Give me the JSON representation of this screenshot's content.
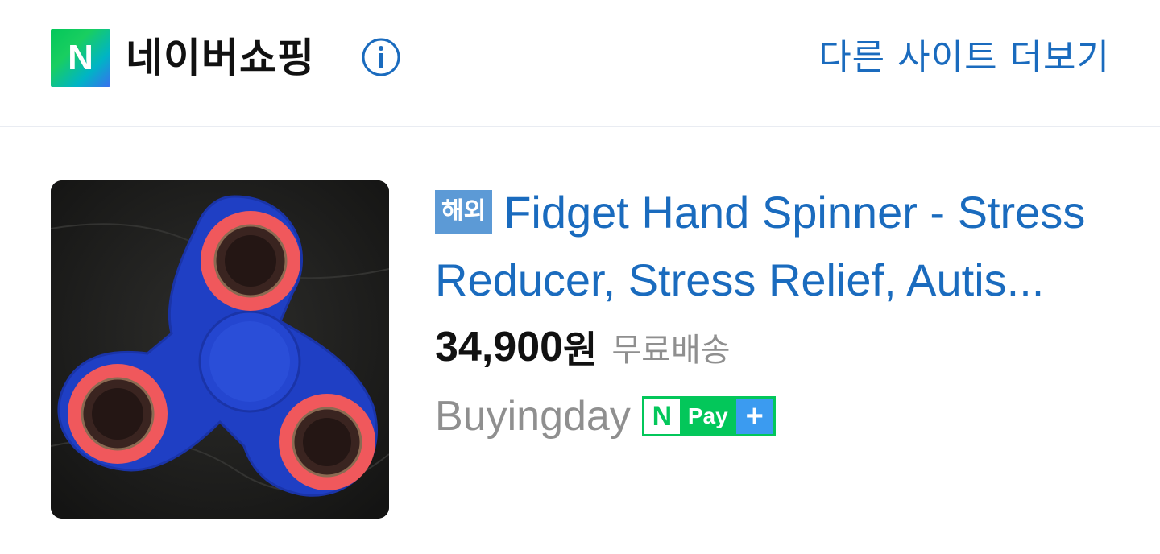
{
  "header": {
    "logo_letter": "N",
    "brand_title": "네이버쇼핑",
    "more_sites_label": "다른 사이트 더보기"
  },
  "product": {
    "badge": "해외",
    "title": "Fidget Hand Spinner - Stress Reducer, Stress Relief, Autis...",
    "price": "34,900",
    "price_unit": "원",
    "shipping": "무료배송",
    "seller": "Buyingday",
    "npay": {
      "n": "N",
      "pay": "Pay",
      "plus": "+"
    }
  },
  "colors": {
    "link_blue": "#1a6bbe",
    "badge_blue": "#5c9ad6",
    "naver_green": "#03c75a",
    "plus_blue": "#3b9bf0",
    "muted_gray": "#8f8f8f",
    "spinner_blue": "#1f3fc4",
    "spinner_ring": "#f0585c"
  },
  "icons": {
    "info": "info-circle-icon"
  }
}
